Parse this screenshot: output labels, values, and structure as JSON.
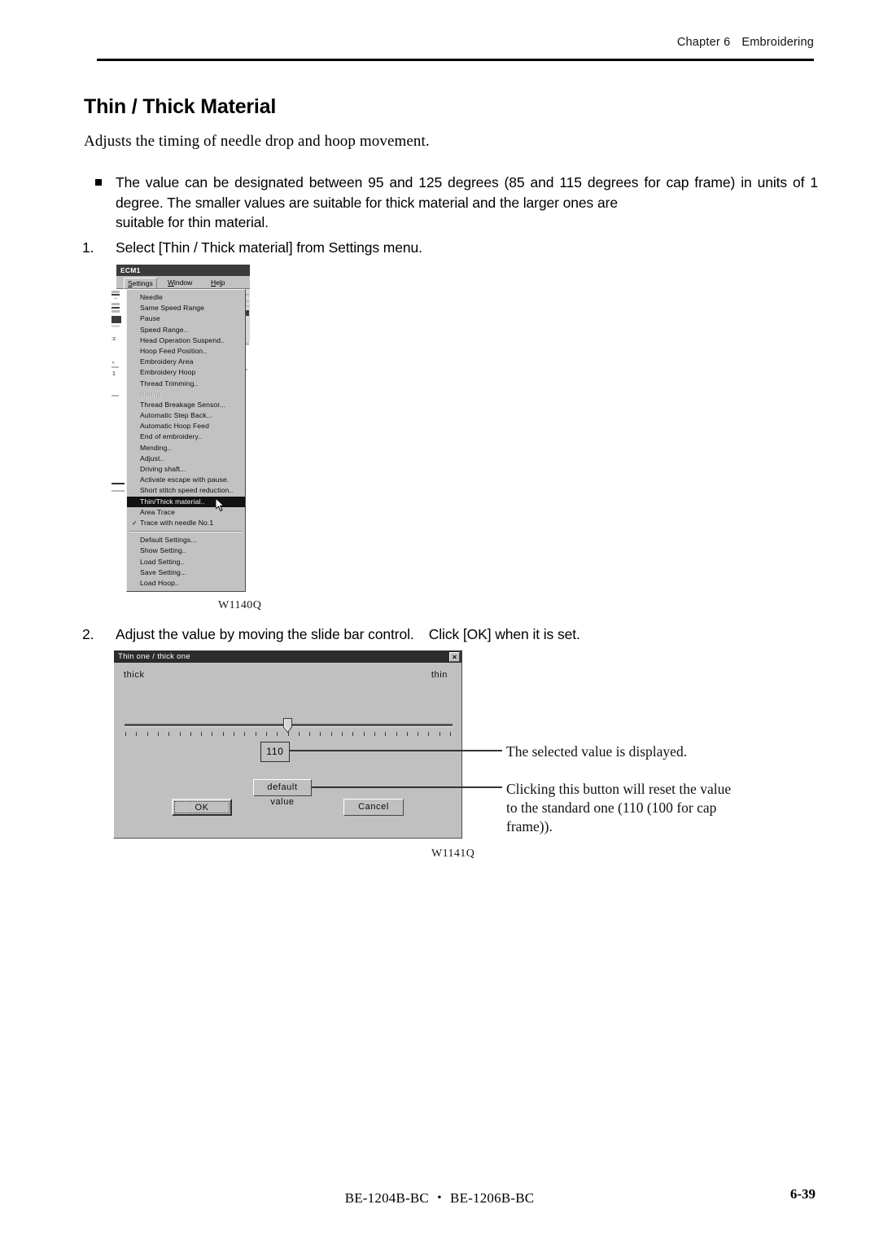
{
  "header": {
    "chapter": "Chapter 6",
    "section": "Embroidering"
  },
  "title": "Thin / Thick Material",
  "subtitle": "Adjusts the timing of needle drop and hoop movement.",
  "bullet": {
    "line1": "The value can be designated between 95 and 125 degrees (85 and 115 degrees for cap frame) in",
    "line2": "units of 1 degree.    The smaller values are suitable for thick material and the larger ones are",
    "line3": "suitable for thin material."
  },
  "steps": [
    {
      "num": "1.",
      "text": "Select [Thin / Thick material] from Settings menu."
    },
    {
      "num": "2.",
      "text": "Adjust the value by moving the slide bar control.",
      "text2": "Click [OK] when it is set."
    }
  ],
  "figures": {
    "menu_caption": "W1140Q",
    "dialog_caption": "W1141Q"
  },
  "menu_screenshot": {
    "window_title": "ECM1",
    "menubar": [
      {
        "label": "Settings",
        "accel": "S",
        "active": true
      },
      {
        "label": "Window",
        "accel": "W",
        "active": false
      },
      {
        "label": "Help",
        "accel": "H",
        "active": false
      }
    ],
    "items": [
      {
        "label": "Needle",
        "submenu": true
      },
      {
        "label": "Same Speed Range",
        "submenu": false
      },
      {
        "label": "Pause",
        "submenu": true
      },
      {
        "label": "Speed Range..",
        "submenu": false
      },
      {
        "label": "Head Operation Suspend..",
        "submenu": false
      },
      {
        "label": "Hoop Feed Position..",
        "submenu": false
      },
      {
        "label": "Embroidery Area",
        "submenu": false
      },
      {
        "label": "Embroidery Hoop",
        "submenu": true
      },
      {
        "label": "Thread Trimming..",
        "submenu": false
      },
      {
        "label": "Boring..",
        "submenu": false,
        "disabled": true
      },
      {
        "label": "Thread Breakage Sensor...",
        "submenu": false
      },
      {
        "label": "Automatic Step Back...",
        "submenu": false
      },
      {
        "label": "Automatic Hoop Feed",
        "submenu": false
      },
      {
        "label": "End of embroidery..",
        "submenu": false
      },
      {
        "label": "Mending..",
        "submenu": false
      },
      {
        "label": "Adjust..",
        "submenu": false
      },
      {
        "label": "Driving shaft...",
        "submenu": false
      },
      {
        "label": "Activate escape with pause.",
        "submenu": false
      },
      {
        "label": "Short stitch speed reduction..",
        "submenu": false
      },
      {
        "label": "Thin/Thick material..",
        "submenu": false,
        "selected": true
      },
      {
        "label": "Area Trace",
        "submenu": true
      },
      {
        "label": "Trace with needle No.1",
        "submenu": false,
        "checked": true
      },
      {
        "separator": true
      },
      {
        "label": "Default Settings...",
        "submenu": false
      },
      {
        "label": "Show Setting..",
        "submenu": false
      },
      {
        "label": "Load Setting..",
        "submenu": false
      },
      {
        "label": "Save Setting...",
        "submenu": false
      },
      {
        "label": "Load Hoop..",
        "submenu": false
      }
    ]
  },
  "dialog": {
    "title": "Thin one / thick one",
    "close_label": "×",
    "label_left": "thick",
    "label_right": "thin",
    "value": "110",
    "slider": {
      "min": 95,
      "max": 125,
      "current": 110,
      "tick_count": 31
    },
    "buttons": {
      "default_value": "default value",
      "ok": "OK",
      "cancel": "Cancel"
    }
  },
  "annotations": {
    "value": "The selected value is displayed.",
    "default_button_l1": "Clicking this button will reset the",
    "default_button_l2": "value to the standard one (110 (100",
    "default_button_l3": "for cap frame))."
  },
  "footer": {
    "models": "BE-1204B-BC ・ BE-1206B-BC",
    "page": "6-39"
  }
}
